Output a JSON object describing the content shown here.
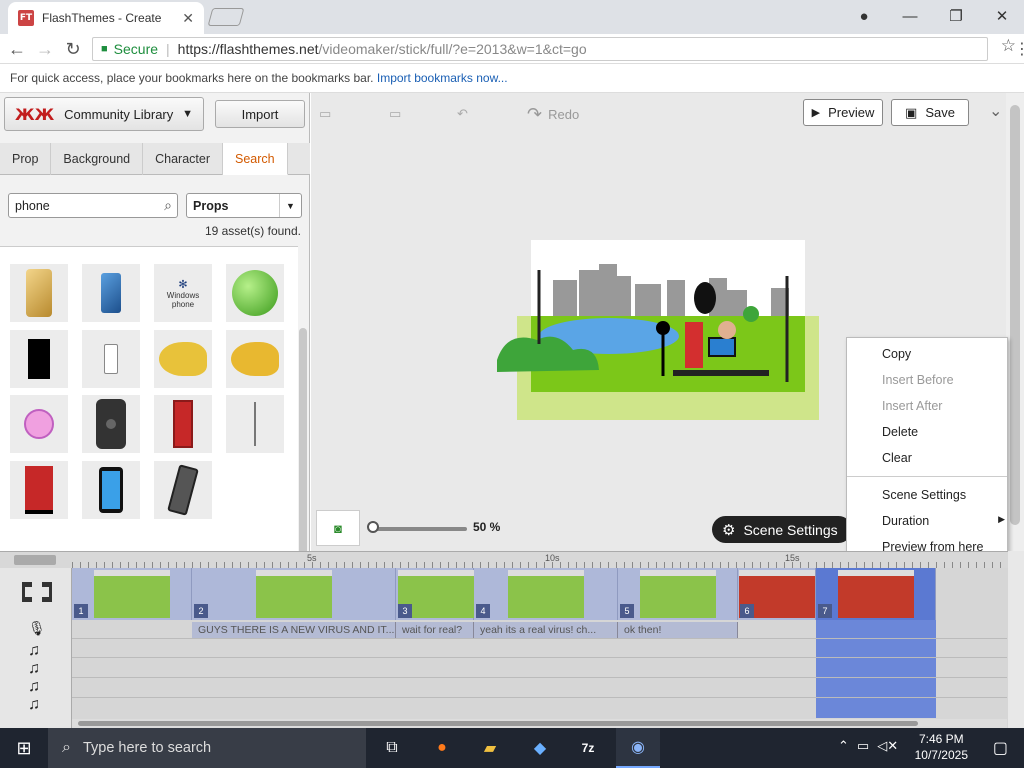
{
  "browser": {
    "tab_title": "FlashThemes - Create",
    "favicon_text": "FT",
    "secure_label": "Secure",
    "url_host": "https://flashthemes.net",
    "url_path": "/videomaker/stick/full/?e=2013&w=1&ct=go",
    "bookmarks_hint": "For quick access, place your bookmarks here on the bookmarks bar.",
    "bookmarks_link": "Import bookmarks now..."
  },
  "left_panel": {
    "library_label": "Community Library",
    "import_label": "Import",
    "tabs": [
      {
        "label": "Prop",
        "active": false
      },
      {
        "label": "Background",
        "active": false
      },
      {
        "label": "Character",
        "active": false
      },
      {
        "label": "Search",
        "active": true
      }
    ],
    "search_value": "phone",
    "category_value": "Props",
    "asset_count": "19 asset(s) found.",
    "assets": [
      "gold-smartphone",
      "blue-smartphone",
      "windows-phone-logo",
      "windows-orb",
      "black-phone",
      "white-phone",
      "yellow-duck-phone",
      "yellow-duck-phone-2",
      "flower-character",
      "black-phone-case",
      "red-phone-booth",
      "antenna",
      "red-phone-booth-2",
      "blue-phone",
      "grey-phone"
    ],
    "windows_phone_text": "Windows phone"
  },
  "toolbar": {
    "redo_label": "Redo",
    "preview_label": "Preview",
    "save_label": "Save"
  },
  "stage": {
    "zoom_value": "50 %",
    "scene_settings_label": "Scene Settings"
  },
  "context_menu": {
    "items": [
      {
        "label": "Copy",
        "enabled": true
      },
      {
        "label": "Insert Before",
        "enabled": false
      },
      {
        "label": "Insert After",
        "enabled": false
      },
      {
        "label": "Delete",
        "enabled": true
      },
      {
        "label": "Clear",
        "enabled": true
      },
      {
        "label": "Scene Settings",
        "enabled": true
      },
      {
        "label": "Duration",
        "enabled": true
      },
      {
        "label": "Preview from here",
        "enabled": true
      }
    ]
  },
  "timeline": {
    "ruler_labels": [
      "5s",
      "10s",
      "15s"
    ],
    "scenes": [
      "1",
      "2",
      "3",
      "4",
      "5",
      "6",
      "7"
    ],
    "speech": [
      "GUYS THERE IS A NEW VIRUS AND IT...",
      "wait for real?",
      "yeah its a real virus! ch...",
      "ok then!"
    ]
  },
  "taskbar": {
    "search_placeholder": "Type here to search",
    "time": "7:46 PM",
    "date": "10/7/2025"
  },
  "colors": {
    "accent_tab": "#d35a00",
    "secure_green": "#1e8e3e",
    "timeline_selected": "#6b87d9",
    "stage_grass": "#8bc34a"
  }
}
